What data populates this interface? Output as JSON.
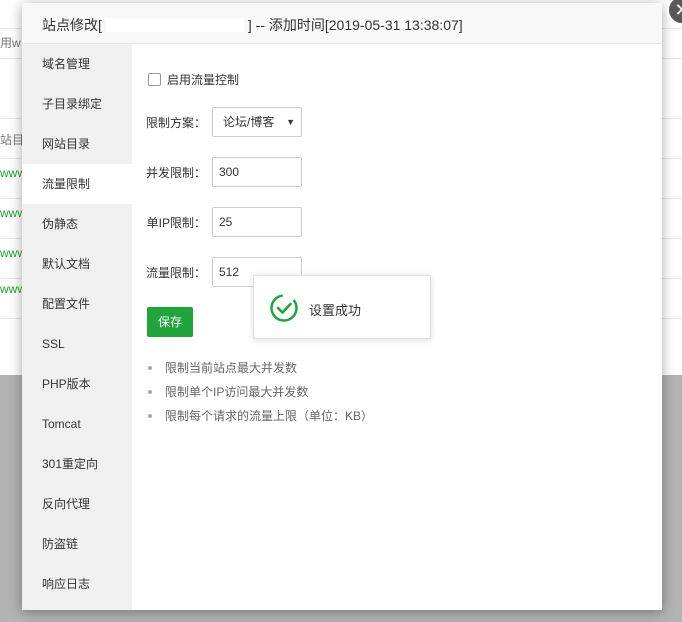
{
  "background": {
    "fragments": [
      "用w",
      "站目",
      "www",
      "www",
      "www",
      "www"
    ]
  },
  "modal": {
    "title_prefix": "站点修改[",
    "title_suffix": "] -- 添加时间[2019-05-31 13:38:07]",
    "close_icon": "close-icon"
  },
  "sidebar": {
    "items": [
      {
        "label": "域名管理"
      },
      {
        "label": "子目录绑定"
      },
      {
        "label": "网站目录"
      },
      {
        "label": "流量限制"
      },
      {
        "label": "伪静态"
      },
      {
        "label": "默认文档"
      },
      {
        "label": "配置文件"
      },
      {
        "label": "SSL"
      },
      {
        "label": "PHP版本"
      },
      {
        "label": "Tomcat"
      },
      {
        "label": "301重定向"
      },
      {
        "label": "反向代理"
      },
      {
        "label": "防盗链"
      },
      {
        "label": "响应日志"
      }
    ],
    "active_index": 3
  },
  "form": {
    "enable_label": "启用流量控制",
    "enabled": false,
    "scheme_label": "限制方案：",
    "scheme_value": "论坛/博客",
    "concurrency_label": "并发限制：",
    "concurrency_value": "300",
    "ip_label": "单IP限制：",
    "ip_value": "25",
    "rate_label": "流量限制：",
    "rate_value": "512",
    "save_label": "保存"
  },
  "tips": [
    "限制当前站点最大并发数",
    "限制单个IP访问最大并发数",
    "限制每个请求的流量上限（单位：KB）"
  ],
  "toast": {
    "message": "设置成功",
    "icon": "check-circle-icon"
  },
  "colors": {
    "accent": "#20a53a",
    "sidebar_bg": "#f0f0f0",
    "header_bg": "#f8f8f8"
  }
}
